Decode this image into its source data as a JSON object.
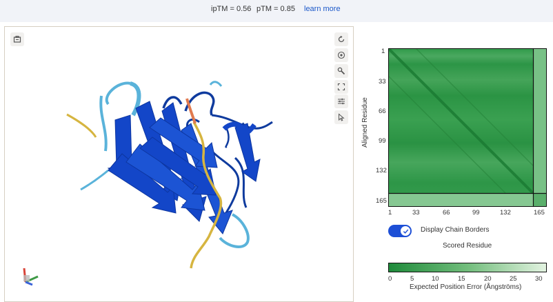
{
  "header": {
    "iptm": "ipTM = 0.56",
    "ptm": "pTM = 0.85",
    "learn_more": "learn more"
  },
  "viewer": {
    "toolbar": [
      "save-icon",
      "rotate-icon",
      "center-icon",
      "wrench-icon",
      "fullscreen-icon",
      "settings-icon",
      "pointer-icon"
    ]
  },
  "pae": {
    "y_label": "Aligned Residue",
    "x_label": "Scored Residue",
    "ticks": [
      "1",
      "33",
      "66",
      "99",
      "132",
      "165"
    ],
    "display_chain_borders": "Display Chain Borders",
    "chain_borders_on": true,
    "colorbar_ticks": [
      "0",
      "5",
      "10",
      "15",
      "20",
      "25",
      "30"
    ],
    "colorbar_label": "Expected Position Error (Ångströms)",
    "color_low": "#1e8a3a",
    "color_high": "#e3f3e1"
  },
  "colors": {
    "strand_blue": "#1346c8",
    "loop_cyan": "#5ab3da",
    "low_conf_yellow": "#d6b540",
    "very_low_orange": "#e07a4f",
    "accent": "#1d4fd6"
  }
}
